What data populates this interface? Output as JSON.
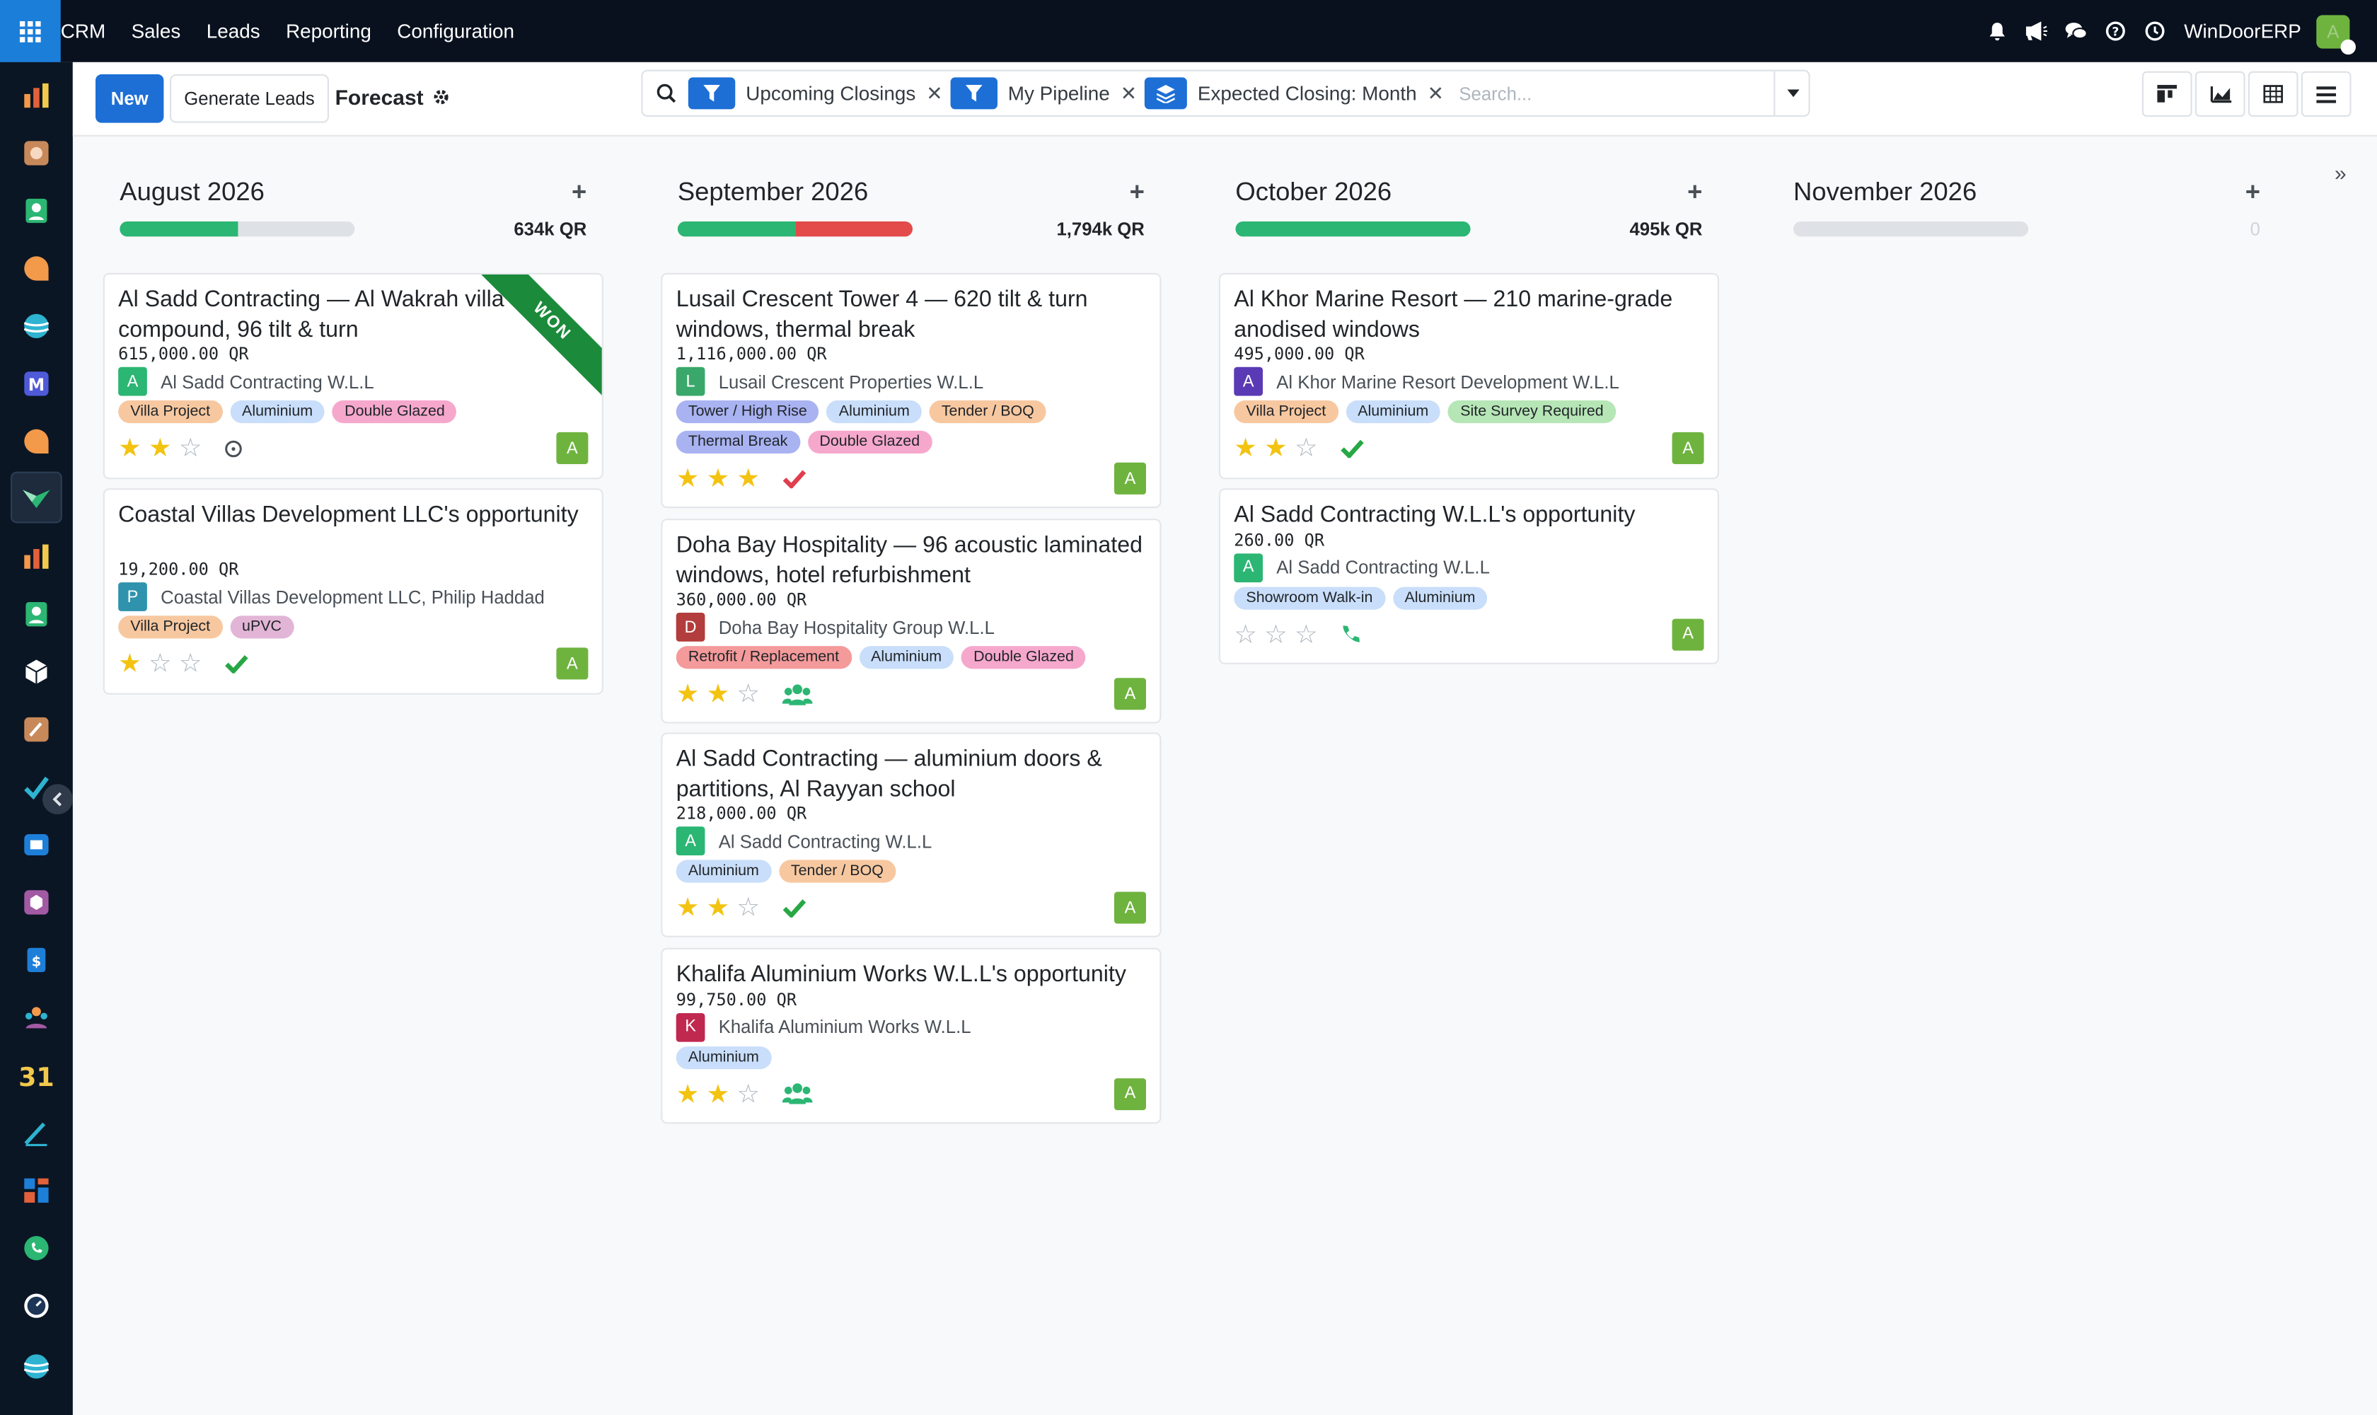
{
  "topbar": {
    "app_name": "CRM",
    "menu": [
      "Sales",
      "Leads",
      "Reporting",
      "Configuration"
    ],
    "company": "WinDoorERP",
    "user_initial": "A"
  },
  "control_panel": {
    "new_label": "New",
    "generate_label": "Generate Leads",
    "breadcrumb": "Forecast",
    "facets": [
      "Upcoming Closings",
      "My Pipeline",
      "Expected Closing: Month"
    ],
    "search_placeholder": "Search...",
    "collapse_icon": "»"
  },
  "columns": [
    {
      "title": "August 2026",
      "total": "634k QR",
      "progress": {
        "green": 0.5,
        "red": 0
      },
      "cards": [
        {
          "title": "Al Sadd Contracting — Al Wakrah villa compound, 96 tilt & turn",
          "amount": "615,000.00 QR",
          "partner": "Al Sadd Contracting W.L.L",
          "initial": "A",
          "avatar_color": "#2bb673",
          "tags": [
            {
              "t": "Villa Project",
              "c": "#f7c8a0"
            },
            {
              "t": "Aluminium",
              "c": "#c9defa"
            },
            {
              "t": "Double Glazed",
              "c": "#f6a8cc"
            }
          ],
          "stars": 2,
          "activity": "clock",
          "ribbon": "WON"
        },
        {
          "title": "Coastal Villas Development LLC's opportunity",
          "amount": "19,200.00 QR",
          "partner": "Coastal Villas Development LLC, Philip Haddad",
          "initial": "P",
          "avatar_color": "#2f93ad",
          "tags": [
            {
              "t": "Villa Project",
              "c": "#f7c8a0"
            },
            {
              "t": "uPVC",
              "c": "#e2b5d6"
            }
          ],
          "stars": 1,
          "activity": "check"
        }
      ]
    },
    {
      "title": "September 2026",
      "total": "1,794k QR",
      "progress": {
        "green": 0.5,
        "red": 0.5
      },
      "cards": [
        {
          "title": "Lusail Crescent Tower 4 — 620 tilt & turn windows, thermal break",
          "amount": "1,116,000.00 QR",
          "partner": "Lusail Crescent Properties W.L.L",
          "initial": "L",
          "avatar_color": "#3aa86b",
          "tags": [
            {
              "t": "Tower / High Rise",
              "c": "#a9b3f2"
            },
            {
              "t": "Aluminium",
              "c": "#c9defa"
            },
            {
              "t": "Tender / BOQ",
              "c": "#f7c8a0"
            },
            {
              "t": "Thermal Break",
              "c": "#a9b3f2"
            },
            {
              "t": "Double Glazed",
              "c": "#f6a8cc"
            }
          ],
          "stars": 3,
          "activity": "check-red"
        },
        {
          "title": "Doha Bay Hospitality — 96 acoustic laminated windows, hotel refurbishment",
          "amount": "360,000.00 QR",
          "partner": "Doha Bay Hospitality Group W.L.L",
          "initial": "D",
          "avatar_color": "#b33c3c",
          "tags": [
            {
              "t": "Retrofit / Replacement",
              "c": "#f49a9a"
            },
            {
              "t": "Aluminium",
              "c": "#c9defa"
            },
            {
              "t": "Double Glazed",
              "c": "#f6a8cc"
            }
          ],
          "stars": 2,
          "activity": "users"
        },
        {
          "title": "Al Sadd Contracting — aluminium doors & partitions, Al Rayyan school",
          "amount": "218,000.00 QR",
          "partner": "Al Sadd Contracting W.L.L",
          "initial": "A",
          "avatar_color": "#2bb673",
          "tags": [
            {
              "t": "Aluminium",
              "c": "#c9defa"
            },
            {
              "t": "Tender / BOQ",
              "c": "#f7c8a0"
            }
          ],
          "stars": 2,
          "activity": "check"
        },
        {
          "title": "Khalifa Aluminium Works W.L.L's opportunity",
          "amount": "99,750.00 QR",
          "partner": "Khalifa Aluminium Works W.L.L",
          "initial": "K",
          "avatar_color": "#c0284f",
          "tags": [
            {
              "t": "Aluminium",
              "c": "#c9defa"
            }
          ],
          "stars": 2,
          "activity": "users"
        }
      ]
    },
    {
      "title": "October 2026",
      "total": "495k QR",
      "progress": {
        "green": 1,
        "red": 0
      },
      "cards": [
        {
          "title": "Al Khor Marine Resort — 210 marine-grade anodised windows",
          "amount": "495,000.00 QR",
          "partner": "Al Khor Marine Resort Development W.L.L",
          "initial": "A",
          "avatar_color": "#5b3ab5",
          "tags": [
            {
              "t": "Villa Project",
              "c": "#f7c8a0"
            },
            {
              "t": "Aluminium",
              "c": "#c9defa"
            },
            {
              "t": "Site Survey Required",
              "c": "#b6e6b6"
            }
          ],
          "stars": 2,
          "activity": "check"
        },
        {
          "title": "Al Sadd Contracting W.L.L's opportunity",
          "amount": "260.00 QR",
          "partner": "Al Sadd Contracting W.L.L",
          "initial": "A",
          "avatar_color": "#2bb673",
          "tags": [
            {
              "t": "Showroom Walk-in",
              "c": "#c9defa"
            },
            {
              "t": "Aluminium",
              "c": "#c9defa"
            }
          ],
          "stars": 0,
          "activity": "phone"
        }
      ]
    },
    {
      "title": "November 2026",
      "total": "0",
      "progress": {
        "green": 0,
        "red": 0
      },
      "cards": []
    }
  ],
  "card_owner_initial": "A"
}
